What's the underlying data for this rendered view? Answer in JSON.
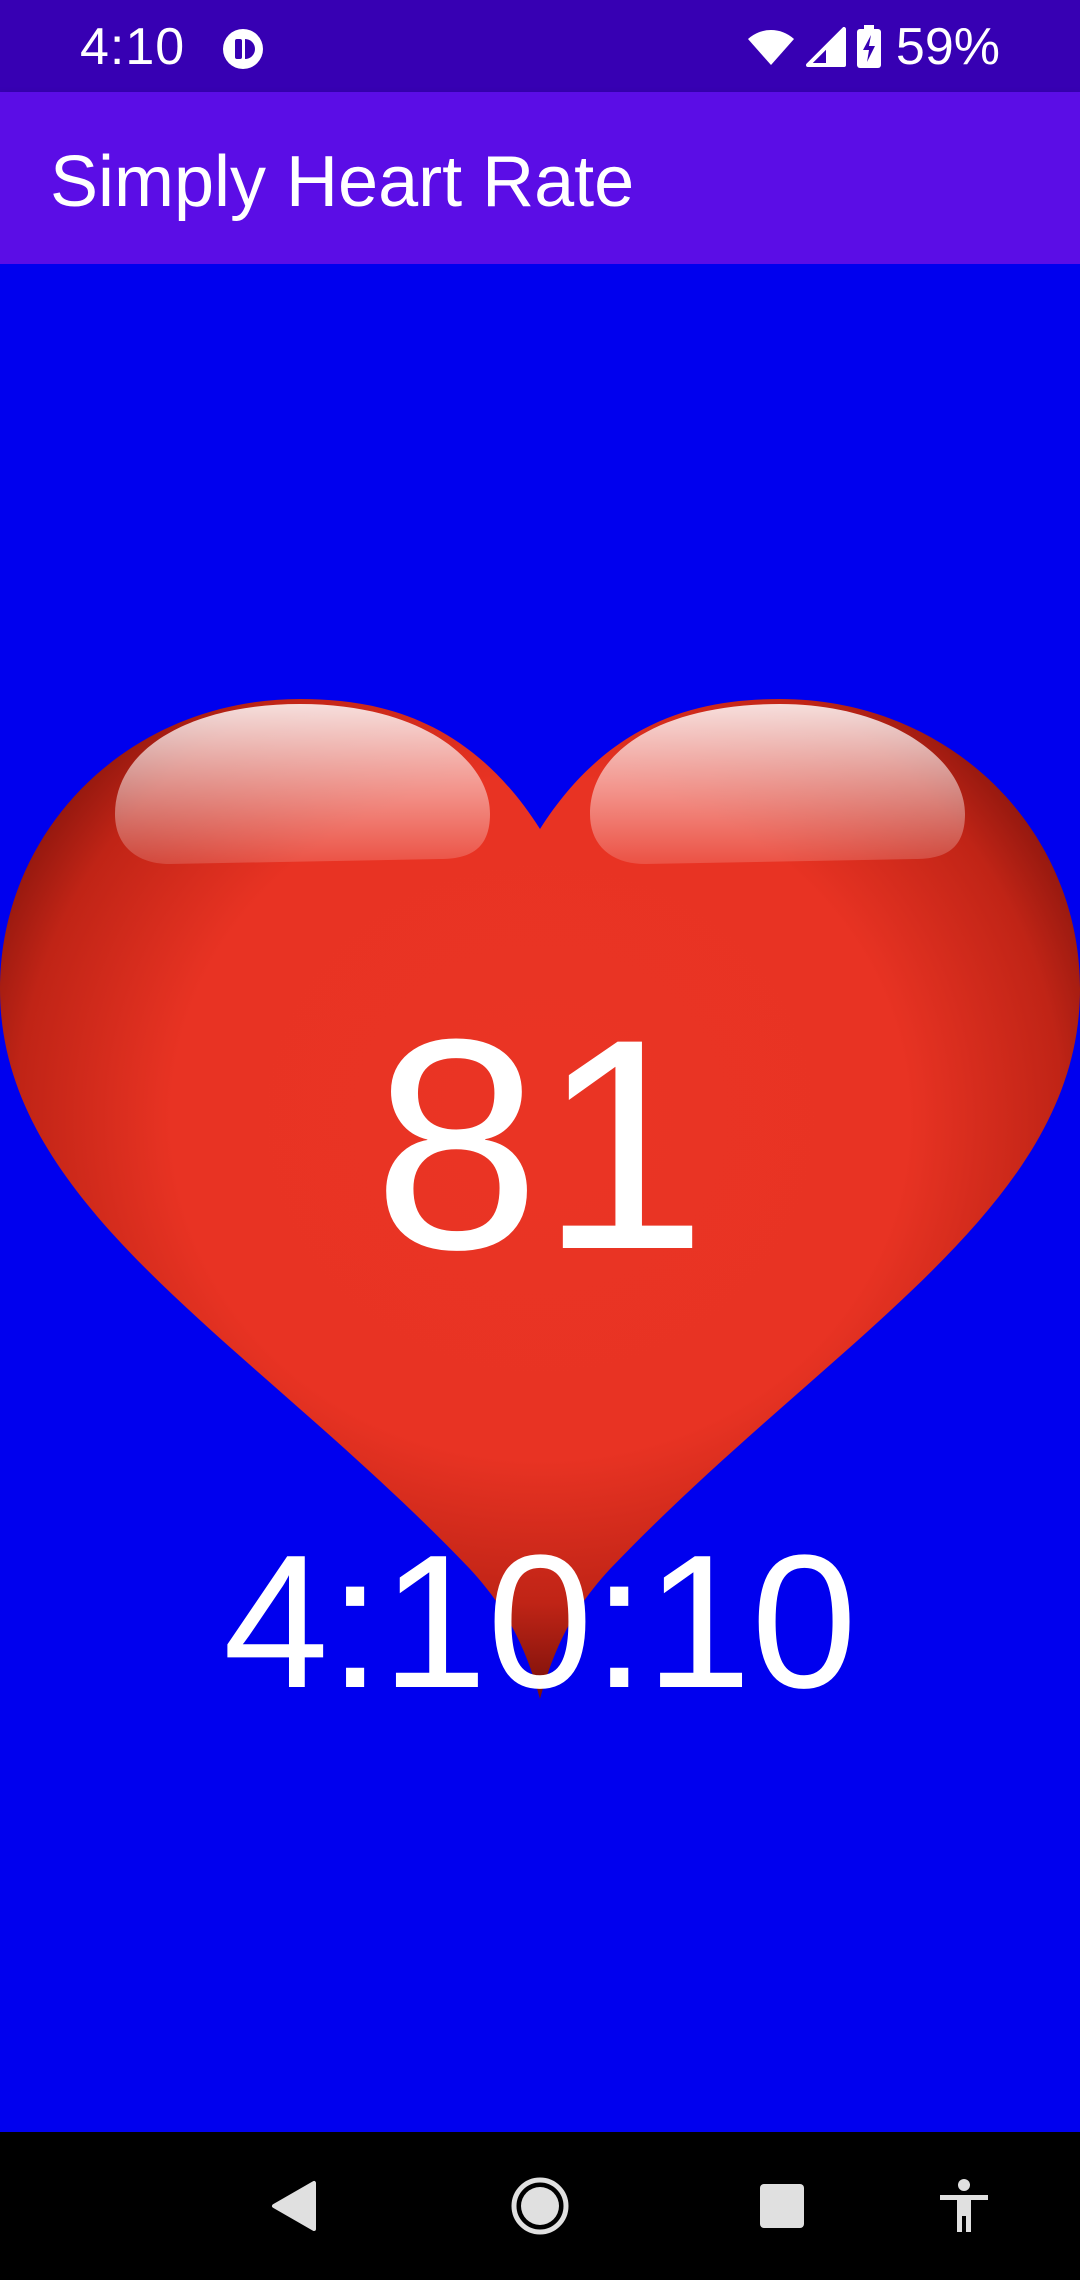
{
  "status_bar": {
    "time": "4:10",
    "battery_percent": "59%",
    "icons": [
      "app-notification-icon",
      "wifi-icon",
      "signal-icon",
      "battery-charging-icon"
    ]
  },
  "app_bar": {
    "title": "Simply Heart Rate"
  },
  "main": {
    "heart_rate": "81",
    "clock": "4:10:10",
    "icon": "heart-icon"
  },
  "nav_bar": {
    "icons": [
      "back-icon",
      "home-icon",
      "recents-icon",
      "accessibility-icon"
    ]
  },
  "colors": {
    "status_bar": "#3700b3",
    "app_bar": "#5b0de6",
    "background": "#0000ee",
    "heart": "#e63322",
    "text": "#ffffff",
    "nav_bar": "#000000"
  }
}
